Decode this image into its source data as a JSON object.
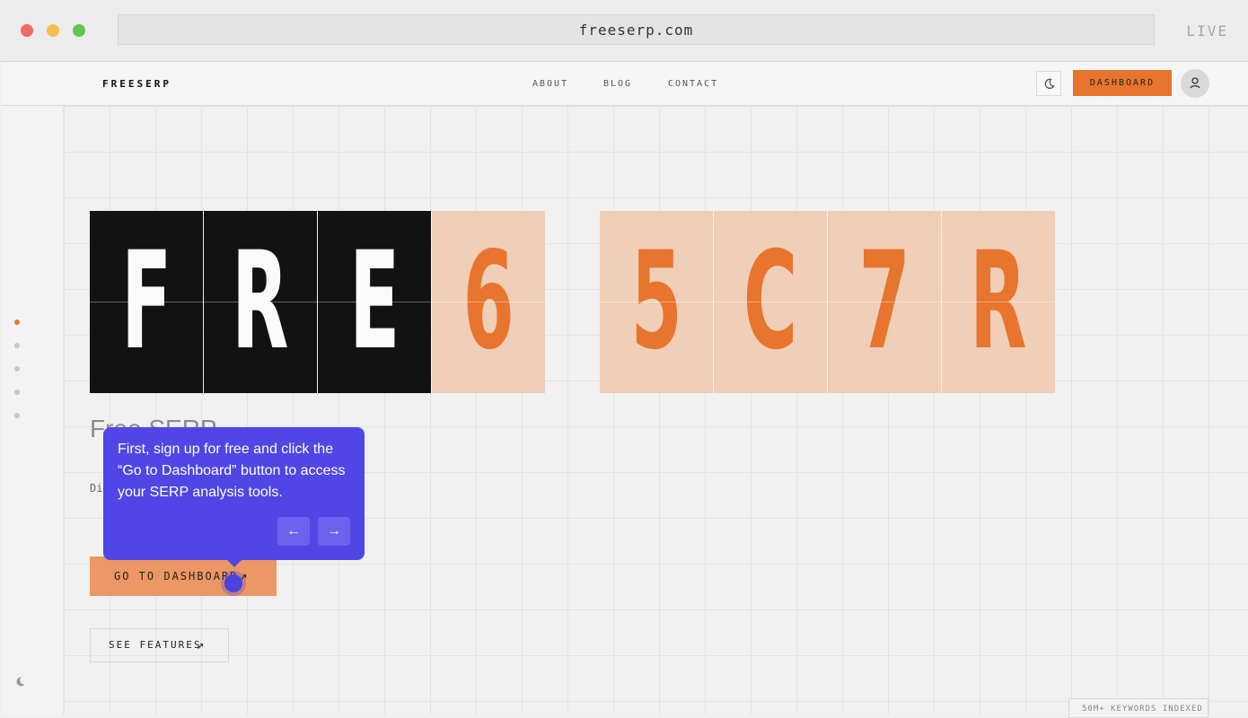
{
  "browser": {
    "url": "freeserp.com",
    "status": "LIVE",
    "traffic_lights": [
      "#ee6b60",
      "#f4bf4f",
      "#61c454"
    ]
  },
  "nav": {
    "brand": "FREESERP",
    "links": [
      "ABOUT",
      "BLOG",
      "CONTACT"
    ],
    "dashboard_label": "DASHBOARD",
    "icons": {
      "theme": "moon-icon",
      "user": "user-icon"
    }
  },
  "sidebar": {
    "dots": 5,
    "active_index": 0,
    "theme_icon": "moon-icon"
  },
  "hero": {
    "tiles": [
      {
        "char": "F",
        "style": "dark"
      },
      {
        "char": "R",
        "style": "dark"
      },
      {
        "char": "E",
        "style": "dark"
      },
      {
        "char": "6",
        "style": "light"
      },
      {
        "char": "5",
        "style": "light"
      },
      {
        "char": "C",
        "style": "light"
      },
      {
        "char": "7",
        "style": "light"
      },
      {
        "char": "R",
        "style": "light"
      }
    ],
    "subtitle": "Free SERP",
    "description": "Di time search ra redit card re evelopers.",
    "cta_label": "GO TO DASHBOARD",
    "features_label": "SEE FEATURES"
  },
  "tooltip": {
    "text": "First, sign up for free and click the “Go to Dashboard” button to access your SERP analysis tools.",
    "prev_icon": "arrow-left-icon",
    "next_icon": "arrow-right-icon"
  },
  "badge": {
    "text": "50M+ KEYWORDS INDEXED"
  },
  "colors": {
    "accent": "#e8752d",
    "tooltip": "#4f46e5",
    "dark_tile": "#121212",
    "light_tile": "#efcfb8"
  }
}
